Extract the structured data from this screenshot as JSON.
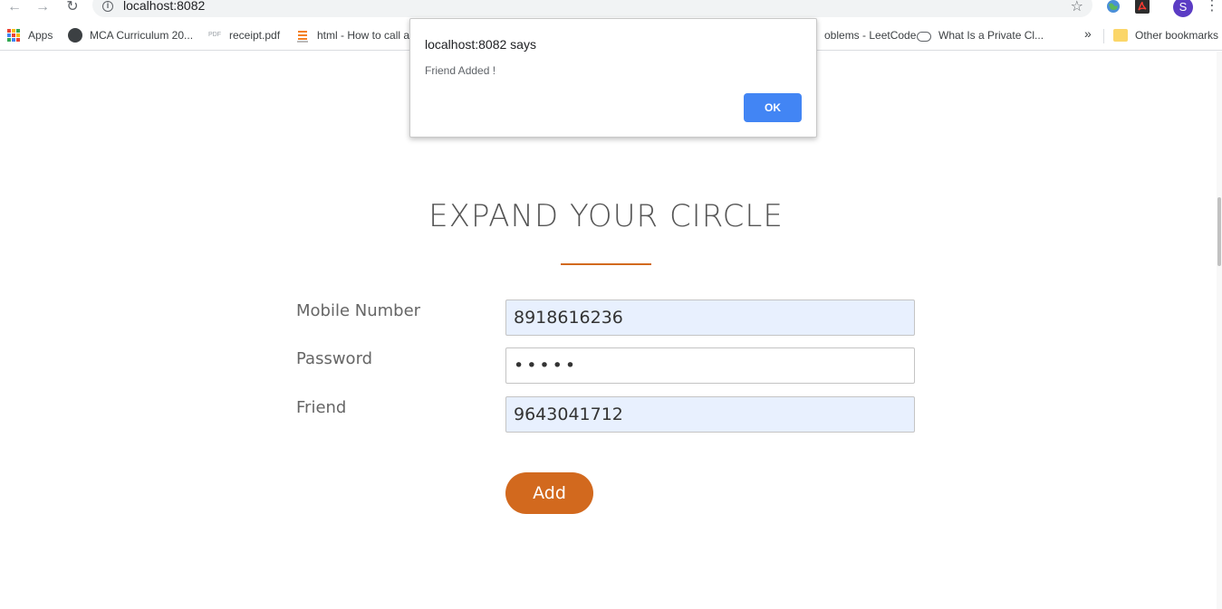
{
  "browser": {
    "url": "localhost:8082",
    "profile_initial": "S"
  },
  "bookmarks": {
    "apps": "Apps",
    "items": [
      {
        "label": "MCA Curriculum 20...",
        "icon": "globe-icon"
      },
      {
        "label": "receipt.pdf",
        "icon": "pdf-icon"
      },
      {
        "label": "html - How to call a",
        "icon": "stackoverflow-icon"
      },
      {
        "label": "oblems - LeetCode",
        "icon": "leetcode-icon"
      },
      {
        "label": "What Is a Private Cl...",
        "icon": "cloud-icon"
      }
    ],
    "more": "»",
    "other": "Other bookmarks"
  },
  "dialog": {
    "title": "localhost:8082 says",
    "message": "Friend Added !",
    "ok_label": "OK"
  },
  "page": {
    "heading": "EXPAND YOUR CIRCLE",
    "accent_color": "#d2691e",
    "form": {
      "mobile_label": "Mobile Number",
      "mobile_value": "8918616236",
      "password_label": "Password",
      "password_value": "•••••",
      "friend_label": "Friend",
      "friend_value": "9643041712",
      "add_label": "Add"
    }
  }
}
